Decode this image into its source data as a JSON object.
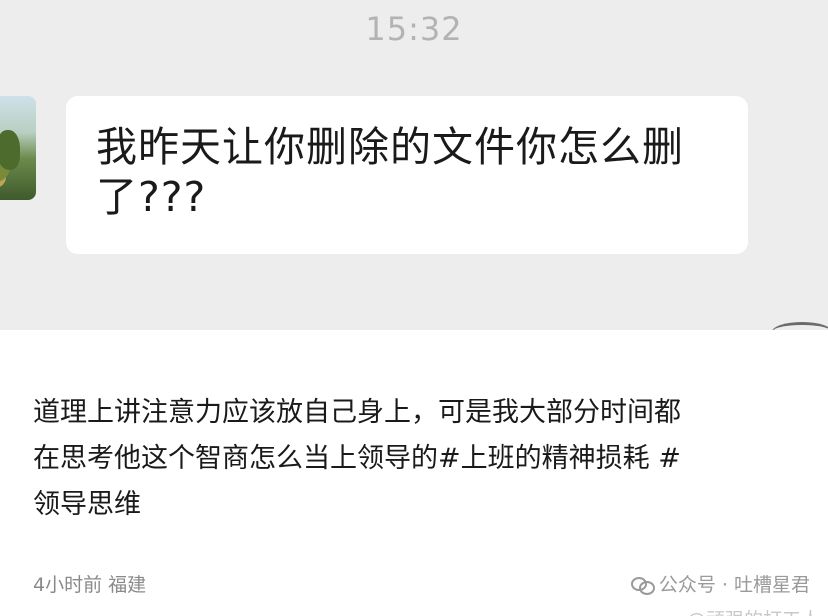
{
  "chat": {
    "timestamp": "15:32",
    "message_line1": "我昨天让你删除的文件你怎么删",
    "message_line2": "了???"
  },
  "post": {
    "body_line1": "道理上讲注意力应该放自己身上，可是我大部分时间都",
    "body_line2_prefix": "在思考他这个智商怎么当上领导的",
    "tag1": "#上班的精神损耗",
    "tag2": "#",
    "body_line3": "领导思维",
    "meta": "4小时前 福建",
    "watermark": "公众号 · 吐槽星君",
    "watermark_sub": "@顽强的打工人"
  }
}
